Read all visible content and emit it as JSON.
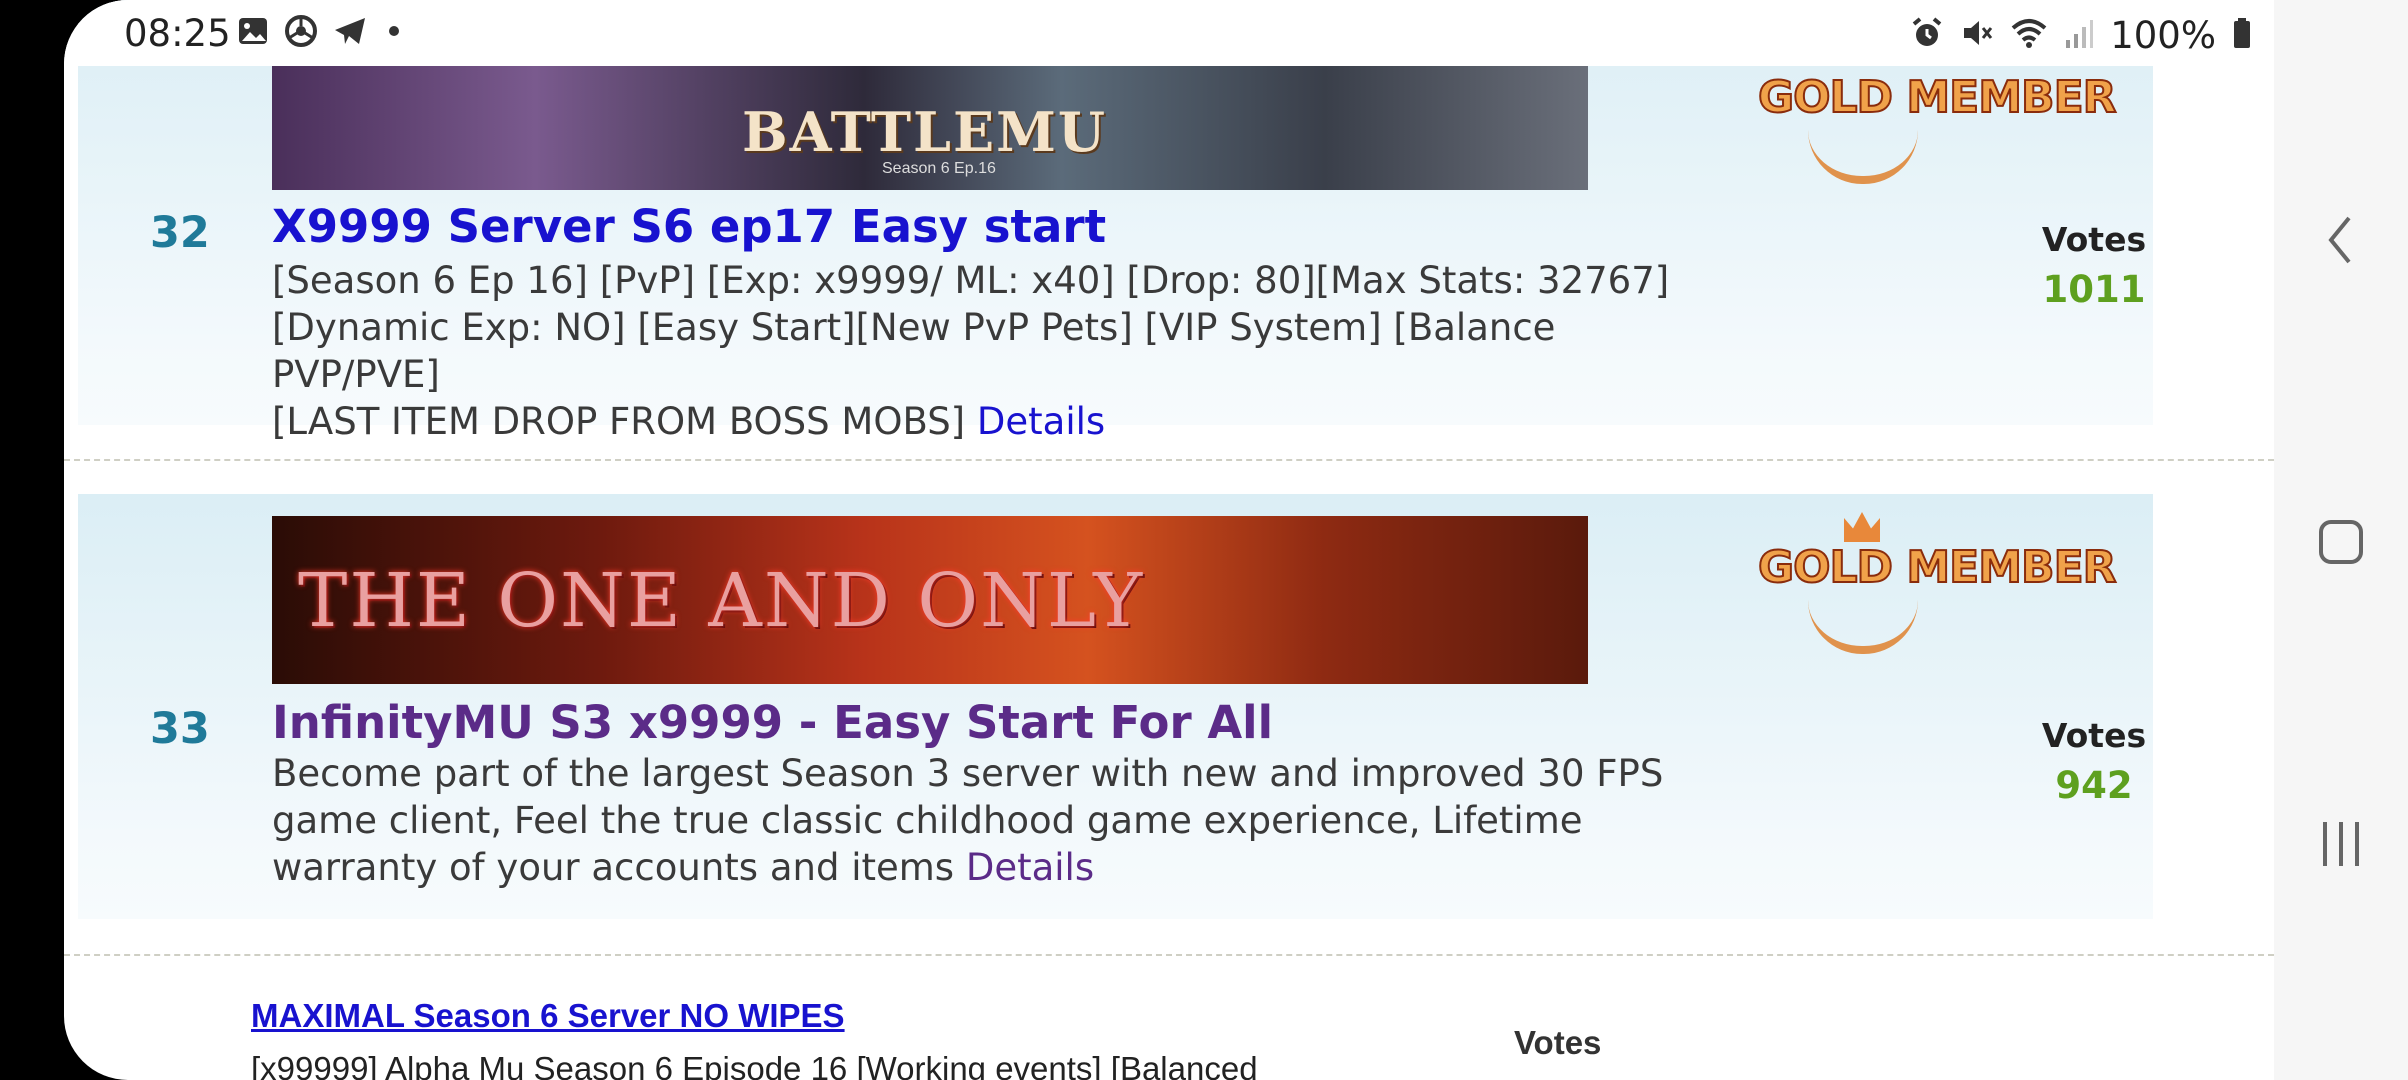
{
  "status_bar": {
    "time": "08:25",
    "battery": "100%",
    "left_icons": [
      "gallery-icon",
      "chrome-icon",
      "telegram-icon",
      "dot-icon"
    ],
    "right_icons": [
      "alarm-icon",
      "mute-icon",
      "wifi-icon",
      "signal-icon",
      "battery-icon"
    ]
  },
  "servers": [
    {
      "rank": "32",
      "banner_text": "BATTLEMU",
      "banner_sub": "Season 6 Ep.16",
      "badge": "GOLD MEMBER",
      "title": "X9999 Server S6 ep17 Easy start",
      "description_lines": [
        "[Season 6 Ep 16] [PvP] [Exp: x9999/ ML: x40] [Drop: 80][Max Stats: 32767]",
        "[Dynamic Exp: NO] [Easy Start][New PvP Pets] [VIP System] [Balance PVP/PVE]",
        "[LAST ITEM DROP FROM BOSS MOBS]"
      ],
      "details_label": "Details",
      "votes_label": "Votes",
      "votes": "1011"
    },
    {
      "rank": "33",
      "banner_text": "THE ONE AND ONLY",
      "badge": "GOLD MEMBER",
      "title": "InfinityMU S3 x9999 - Easy Start For All",
      "description_lines": [
        "Become part of the largest Season 3 server with new and improved 30 FPS",
        "game client, Feel the true classic childhood game experience, Lifetime",
        "warranty of your accounts and items"
      ],
      "details_label": "Details",
      "votes_label": "Votes",
      "votes": "942"
    }
  ],
  "plain_listing": {
    "title": "MAXIMAL Season 6 Server NO WIPES",
    "description": "[x99999] Alpha Mu Season 6 Episode 16 [Working events] [Balanced",
    "votes_label": "Votes"
  },
  "nav_bar": {
    "buttons": [
      "back-icon",
      "home-icon",
      "recents-icon"
    ]
  }
}
